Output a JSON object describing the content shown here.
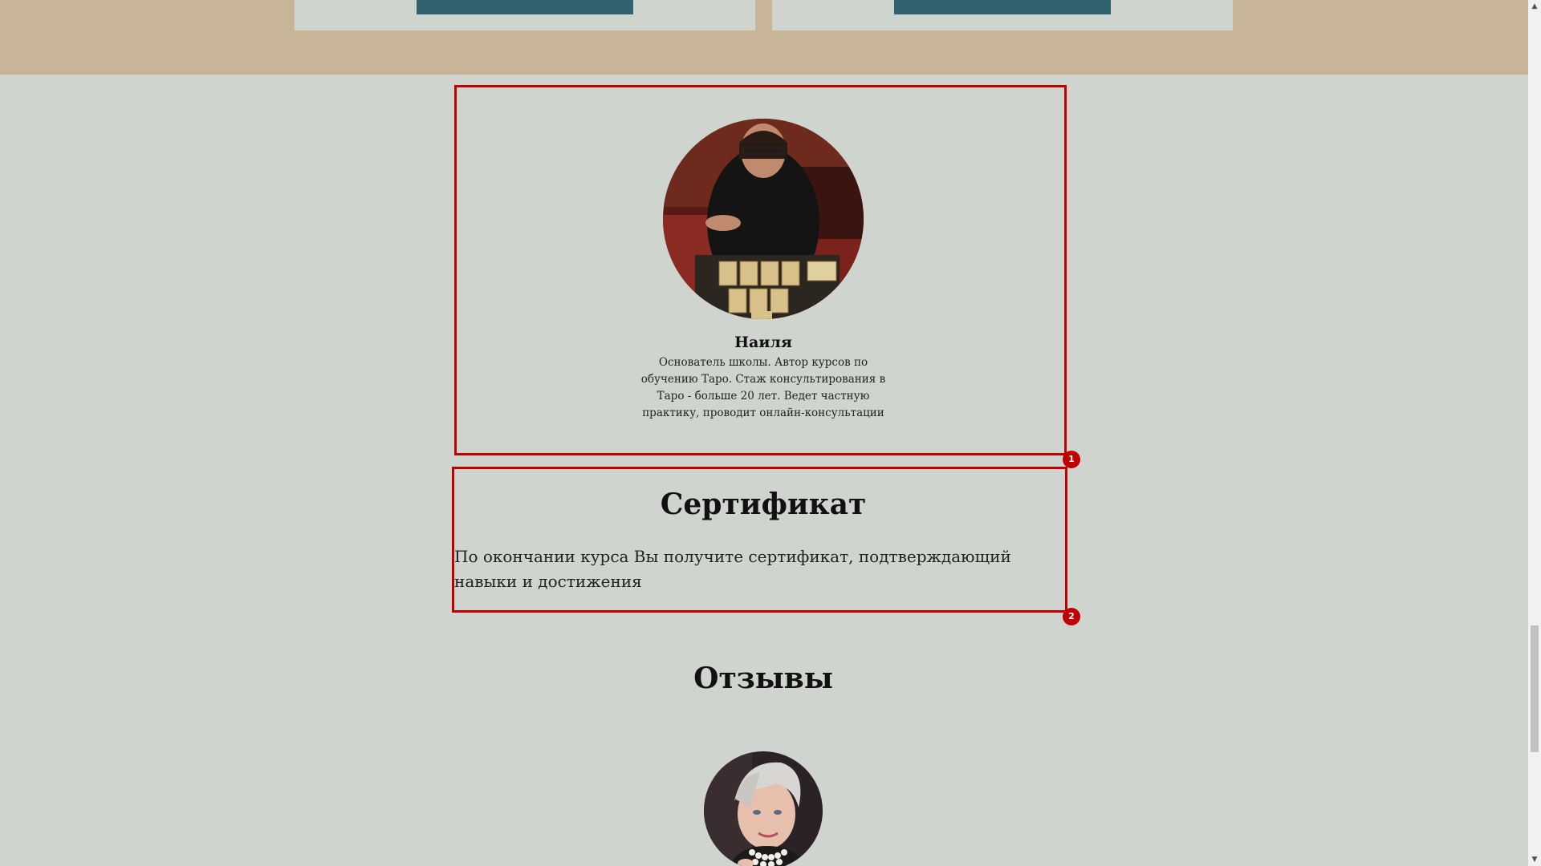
{
  "author": {
    "name": "Наиля",
    "bio": "Основатель школы. Автор курсов по обучению Таро. Стаж консультирования в Таро - больше 20 лет. Ведет частную практику, проводит онлайн-консультации"
  },
  "certificate": {
    "title": "Сертификат",
    "text": "По окончании курса Вы получите сертификат, подтверждающий навыки и достижения"
  },
  "reviews": {
    "title": "Отзывы"
  },
  "annotations": [
    "1",
    "2"
  ],
  "icons": {
    "scroll_up": "scroll-up-arrow-icon",
    "scroll_down": "scroll-down-arrow-icon"
  },
  "colors": {
    "page_bg": "#d0d4cf",
    "band_bg": "#c8b598",
    "button": "#2f626c",
    "annotation": "#c00000"
  }
}
